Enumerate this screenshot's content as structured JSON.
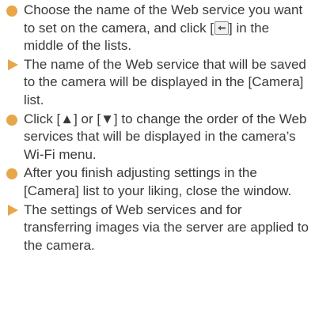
{
  "colors": {
    "bullet": "#e8a64a",
    "text": "#3a3a3a"
  },
  "items": [
    {
      "marker": "dot",
      "text_before": "Choose the name of the Web service you want to set on the camera, and click [",
      "button_icon": "left-arrow-icon",
      "text_after": "] in the middle of the lists."
    },
    {
      "marker": "triangle",
      "text": "The name of the Web service that will be saved to the camera will be displayed in the [Camera] list."
    },
    {
      "marker": "dot",
      "text": "Click [▲] or [▼] to change the order of the Web services that will be displayed in the camera’s Wi-Fi menu."
    },
    {
      "marker": "dot",
      "text": "After you finish adjusting settings in the [Camera] list to your liking, close the window."
    },
    {
      "marker": "triangle",
      "text": "The settings of Web services and for transferring images via the server are applied to the camera."
    }
  ]
}
